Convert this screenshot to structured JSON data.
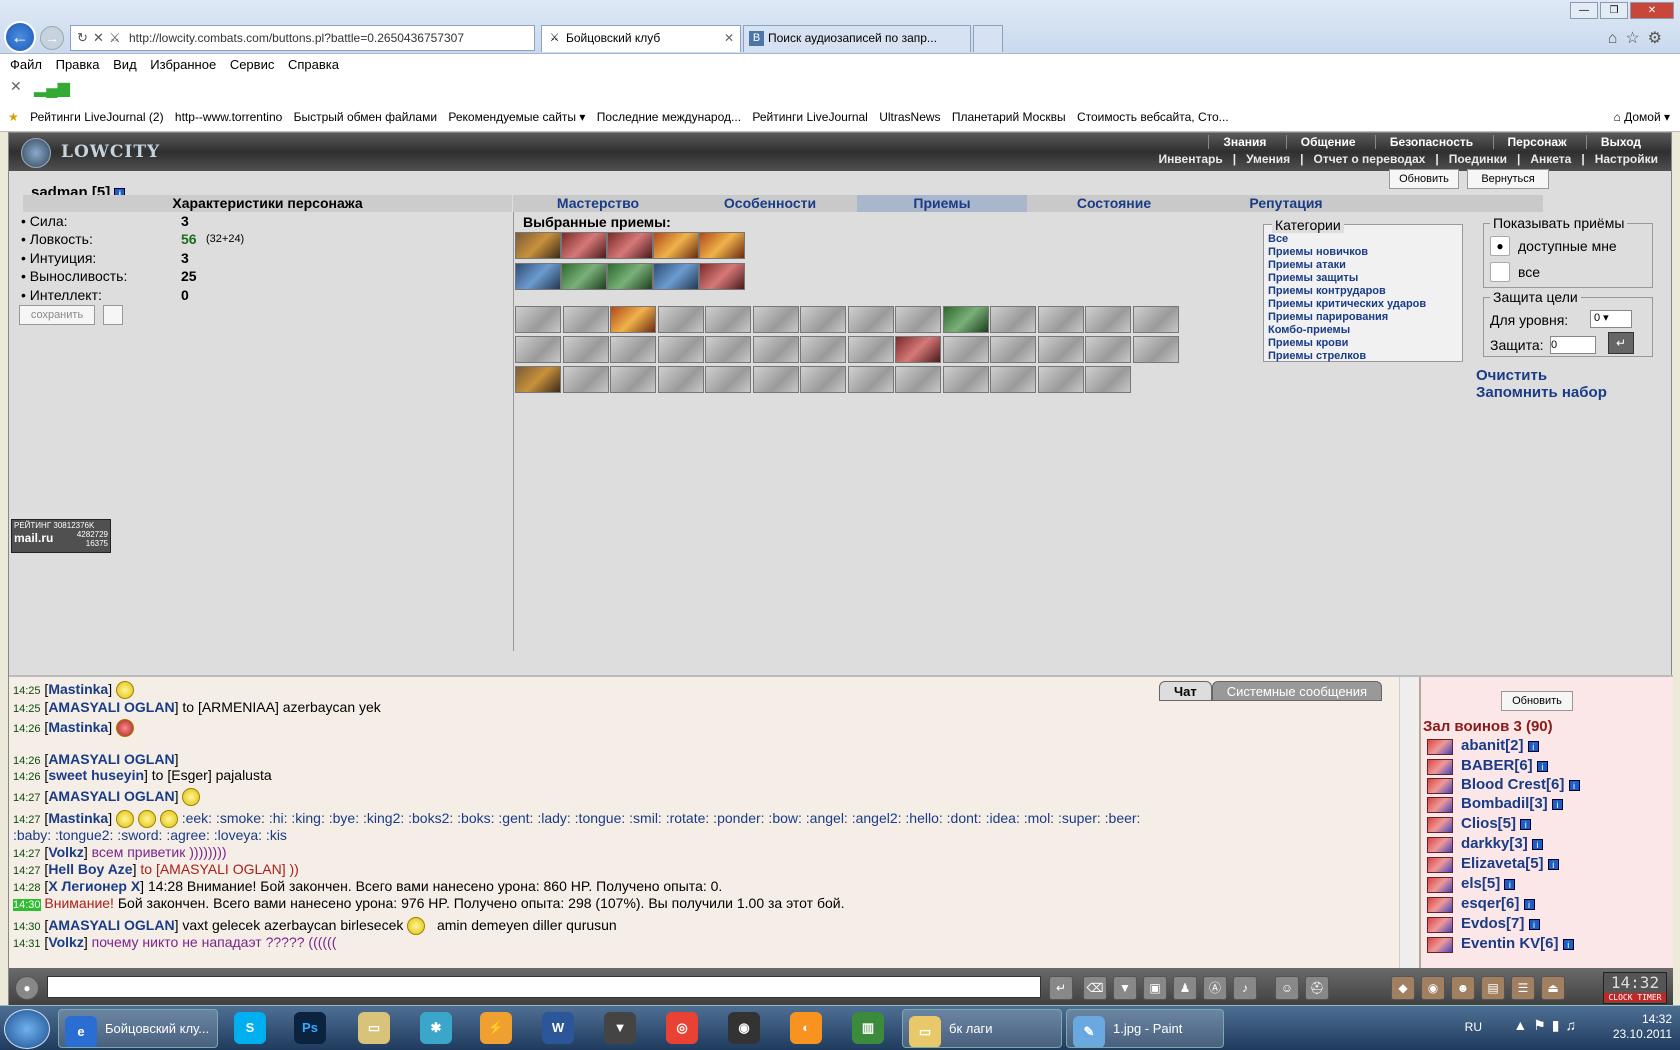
{
  "browser": {
    "url": "http://lowcity.combats.com/buttons.pl?battle=0.2650436757307",
    "tabs": [
      {
        "label": "Бойцовский клуб"
      },
      {
        "label": "Поиск аудиозаписей по запр..."
      }
    ],
    "menu": [
      "Файл",
      "Правка",
      "Вид",
      "Избранное",
      "Сервис",
      "Справка"
    ],
    "favorites": [
      "Рейтинги LiveJournal (2)",
      "http--www.torrentino",
      "Быстрый обмен файлами",
      "Рекомендуемые сайты ▾",
      "Последние международ...",
      "Рейтинги LiveJournal",
      "UltrasNews",
      "Планетарий Москвы",
      "Стоимость вебсайта, Сто..."
    ],
    "fav_home": "Домой"
  },
  "game": {
    "logo": "LOWCITY",
    "nav_top": [
      "Знания",
      "Общение",
      "Безопасность",
      "Персонаж",
      "Выход"
    ],
    "nav_sub": [
      "Инвентарь",
      "|",
      "Умения",
      "|",
      "Отчет о переводах",
      "|",
      "Поединки",
      "|",
      "Анкета",
      "|",
      "Настройки"
    ],
    "char_name": "sadman [5]",
    "btn_refresh": "Обновить",
    "btn_back": "Вернуться",
    "stats_title": "Характеристики персонажа",
    "stats": [
      {
        "label": "• Сила:",
        "value": "3",
        "extra": ""
      },
      {
        "label": "• Ловкость:",
        "value": "56",
        "extra": "(32+24)"
      },
      {
        "label": "• Интуиция:",
        "value": "3",
        "extra": ""
      },
      {
        "label": "• Выносливость:",
        "value": "25",
        "extra": ""
      },
      {
        "label": "• Интеллект:",
        "value": "0",
        "extra": ""
      }
    ],
    "save_btn": "сохранить",
    "tabs": [
      "Мастерство",
      "Особенности",
      "Приемы",
      "Состояние",
      "Репутация"
    ],
    "selected_title": "Выбранные приемы:",
    "categories_title": "Категории",
    "categories": [
      "Все",
      "Приемы новичков",
      "Приемы атаки",
      "Приемы защиты",
      "Приемы контрударов",
      "Приемы критических ударов",
      "Приемы парирования",
      "Комбо-приемы",
      "Приемы крови",
      "Приемы стрелков"
    ],
    "show_title": "Показывать приёмы",
    "show_opt1": "доступные мне",
    "show_opt2": "все",
    "defense_title": "Защита цели",
    "def_level_label": "Для уровня:",
    "def_level_value": "0",
    "def_label": "Защита:",
    "def_value": "0",
    "clear_link": "Очистить",
    "save_set_link": "Запомнить набор",
    "mailru": {
      "label": "РЕЙТИНГ",
      "v1": "30812376K",
      "v2": "4282729",
      "v3": "16375",
      "brand": "mail.ru"
    }
  },
  "chat": {
    "tab_chat": "Чат",
    "tab_sys": "Системные сообщения",
    "lines": [
      {
        "t": "14:25",
        "n": "Mastinka",
        "rest": ""
      },
      {
        "t": "14:25",
        "n": "AMASYALI OGLAN",
        "rest": " to [ARMENIAA] azerbaycan yek"
      },
      {
        "t": "14:26",
        "n": "Mastinka",
        "rest": ""
      },
      {
        "t": "14:26",
        "n": "AMASYALI OGLAN",
        "rest": ""
      },
      {
        "t": "14:26",
        "n": "sweet huseyin",
        "rest": " to [Esger] pajalusta"
      },
      {
        "t": "14:27",
        "n": "AMASYALI OGLAN",
        "rest": ""
      },
      {
        "t": "14:27",
        "n": "Mastinka",
        "rest": ":eek: :smoke: :hi: :king: :bye: :king2: :boks2: :boks: :gent: :lady: :tongue: :smil: :rotate: :ponder: :bow: :angel: :angel2: :hello: :dont: :idea: :mol: :super: :beer:"
      },
      {
        "t": "",
        "n": "",
        "rest": ":baby: :tongue2: :sword: :agree: :loveya: :kis"
      },
      {
        "t": "14:27",
        "n": "Volkz",
        "rest": "всем приветик ))))))))"
      },
      {
        "t": "14:27",
        "n": "Hell Boy Aze",
        "rest": "to [AMASYALI OGLAN] ))"
      },
      {
        "t": "14:28",
        "n": "X Легионер X",
        "rest": " 14:28 Внимание! Бой закончен. Всего вами нанесено урона: 860 HP. Получено опыта: 0."
      },
      {
        "t": "14:30",
        "n": "",
        "rest": "Бой закончен. Всего вами нанесено урона: 976 HP. Получено опыта: 298 (107%). Вы получили 1.00 за этот бой."
      },
      {
        "t": "14:30",
        "n": "AMASYALI OGLAN",
        "rest": " vaxt gelecek azerbaycan birlesecek"
      },
      {
        "t": "14:31",
        "n": "Volkz",
        "rest": "почему никто не нападаэт ????? (((((("
      }
    ],
    "warn_word": "Внимание!",
    "amin": "amin demeyen diller qurusun"
  },
  "users": {
    "refresh": "Обновить",
    "hall": "Зал воинов 3 (90)",
    "list": [
      "abanit[2]",
      "BABER[6]",
      "Blood Crest[6]",
      "Bombadil[3]",
      "Clios[5]",
      "darkky[3]",
      "Elizaveta[5]",
      "els[5]",
      "esqer[6]",
      "Evdos[7]",
      "Eventin KV[6]"
    ]
  },
  "clock": {
    "time": "14:32",
    "label1": "CLOCK",
    "label2": "TIMER"
  },
  "taskbar": {
    "items": [
      "Бойцовский клу...",
      "бк лаги",
      "1.jpg - Paint"
    ],
    "lang": "RU",
    "time": "14:32",
    "date": "23.10.2011"
  }
}
